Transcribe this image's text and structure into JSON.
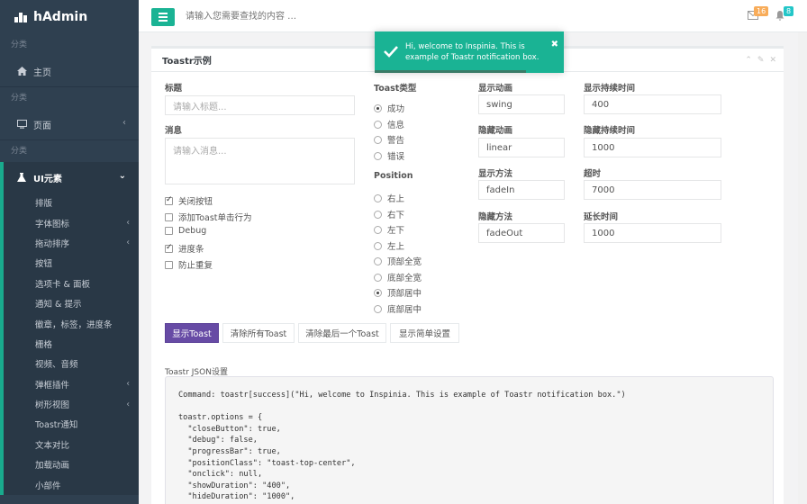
{
  "sidebar": {
    "brand": "hAdmin",
    "section1": "分类",
    "home": "主页",
    "section2": "分类",
    "pages": "页面",
    "section3": "分类",
    "ui": "UI元素",
    "sub_items": [
      "排版",
      "字体图标",
      "拖动排序",
      "按钮",
      "选项卡 & 面板",
      "通知 & 提示",
      "徽章，标签，进度条",
      "栅格",
      "视频、音频",
      "弹框插件",
      "树形视图",
      "Toastr通知",
      "文本对比",
      "加载动画",
      "小部件"
    ]
  },
  "topbar": {
    "search_placeholder": "请输入您需要查找的内容 …",
    "mail_count": "16",
    "bell_count": "8"
  },
  "panel": {
    "title": "Toastr示例",
    "title_label": "标题",
    "title_placeholder": "请输入标题...",
    "message_label": "消息",
    "message_placeholder": "请输入消息...",
    "checkboxes": [
      {
        "label": "关闭按钮",
        "checked": true
      },
      {
        "label": "添加Toast单击行为",
        "checked": false
      },
      {
        "label": "Debug",
        "checked": false
      },
      {
        "label": "进度条",
        "checked": true
      },
      {
        "label": "防止重复",
        "checked": false
      }
    ],
    "type_label": "Toast类型",
    "types": [
      {
        "label": "成功",
        "checked": true
      },
      {
        "label": "信息",
        "checked": false
      },
      {
        "label": "警告",
        "checked": false
      },
      {
        "label": "错误",
        "checked": false
      }
    ],
    "position_label": "Position",
    "positions": [
      {
        "label": "右上",
        "checked": false
      },
      {
        "label": "右下",
        "checked": false
      },
      {
        "label": "左下",
        "checked": false
      },
      {
        "label": "左上",
        "checked": false
      },
      {
        "label": "顶部全宽",
        "checked": false
      },
      {
        "label": "底部全宽",
        "checked": false
      },
      {
        "label": "顶部居中",
        "checked": true
      },
      {
        "label": "底部居中",
        "checked": false
      }
    ],
    "show_anim_label": "显示动画",
    "show_anim": "swing",
    "hide_anim_label": "隐藏动画",
    "hide_anim": "linear",
    "show_method_label": "显示方法",
    "show_method": "fadeIn",
    "hide_method_label": "隐藏方法",
    "hide_method": "fadeOut",
    "show_dur_label": "显示持续时间",
    "show_dur": "400",
    "hide_dur_label": "隐藏持续时间",
    "hide_dur": "1000",
    "timeout_label": "超时",
    "timeout": "7000",
    "ext_label": "延长时间",
    "ext": "1000",
    "buttons": [
      "显示Toast",
      "清除所有Toast",
      "清除最后一个Toast",
      "显示简单设置"
    ],
    "json_label": "Toastr JSON设置",
    "code": "Command: toastr[success](\"Hi, welcome to Inspinia. This is example of Toastr notification box.\")\n\ntoastr.options = {\n  \"closeButton\": true,\n  \"debug\": false,\n  \"progressBar\": true,\n  \"positionClass\": \"toast-top-center\",\n  \"onclick\": null,\n  \"showDuration\": \"400\",\n  \"hideDuration\": \"1000\","
  },
  "toast": {
    "message": "Hi, welcome to Inspinia. This is example of Toastr notification box.",
    "close": "✖",
    "progress": 0.8
  },
  "colors": {
    "accent": "#1ab394",
    "sidebar": "#2f4050",
    "primary_button": "#674ba5"
  }
}
